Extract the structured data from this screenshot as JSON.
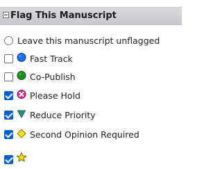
{
  "panel": {
    "title": "Flag This Manuscript"
  },
  "options": [
    {
      "id": "unflagged",
      "control": "radio",
      "checked": false,
      "icon": "none",
      "label": "Leave this manuscript unflagged"
    },
    {
      "id": "fast-track",
      "control": "checkbox",
      "checked": false,
      "icon": "blue-circle-icon",
      "label": "Fast Track"
    },
    {
      "id": "co-publish",
      "control": "checkbox",
      "checked": false,
      "icon": "green-circle-icon",
      "label": "Co-Publish"
    },
    {
      "id": "please-hold",
      "control": "checkbox",
      "checked": true,
      "icon": "pink-x-circle-icon",
      "label": "Please Hold"
    },
    {
      "id": "reduce-priority",
      "control": "checkbox",
      "checked": true,
      "icon": "teal-down-triangle-icon",
      "label": "Reduce Priority"
    },
    {
      "id": "second-opinion",
      "control": "checkbox",
      "checked": true,
      "icon": "yellow-diamond-icon",
      "label": "Second Opinion Required"
    },
    {
      "id": "star",
      "control": "checkbox",
      "checked": true,
      "icon": "yellow-star-icon",
      "label": ""
    }
  ],
  "colors": {
    "checkbox_checked": "#0a62c9",
    "blue_circle": "#1a6fe0",
    "green_circle": "#1f8c1f",
    "pink_x": "#d62f98",
    "teal_triangle": "#2f8f86",
    "yellow_diamond": "#f3e21a",
    "yellow_star": "#f3e21a"
  }
}
